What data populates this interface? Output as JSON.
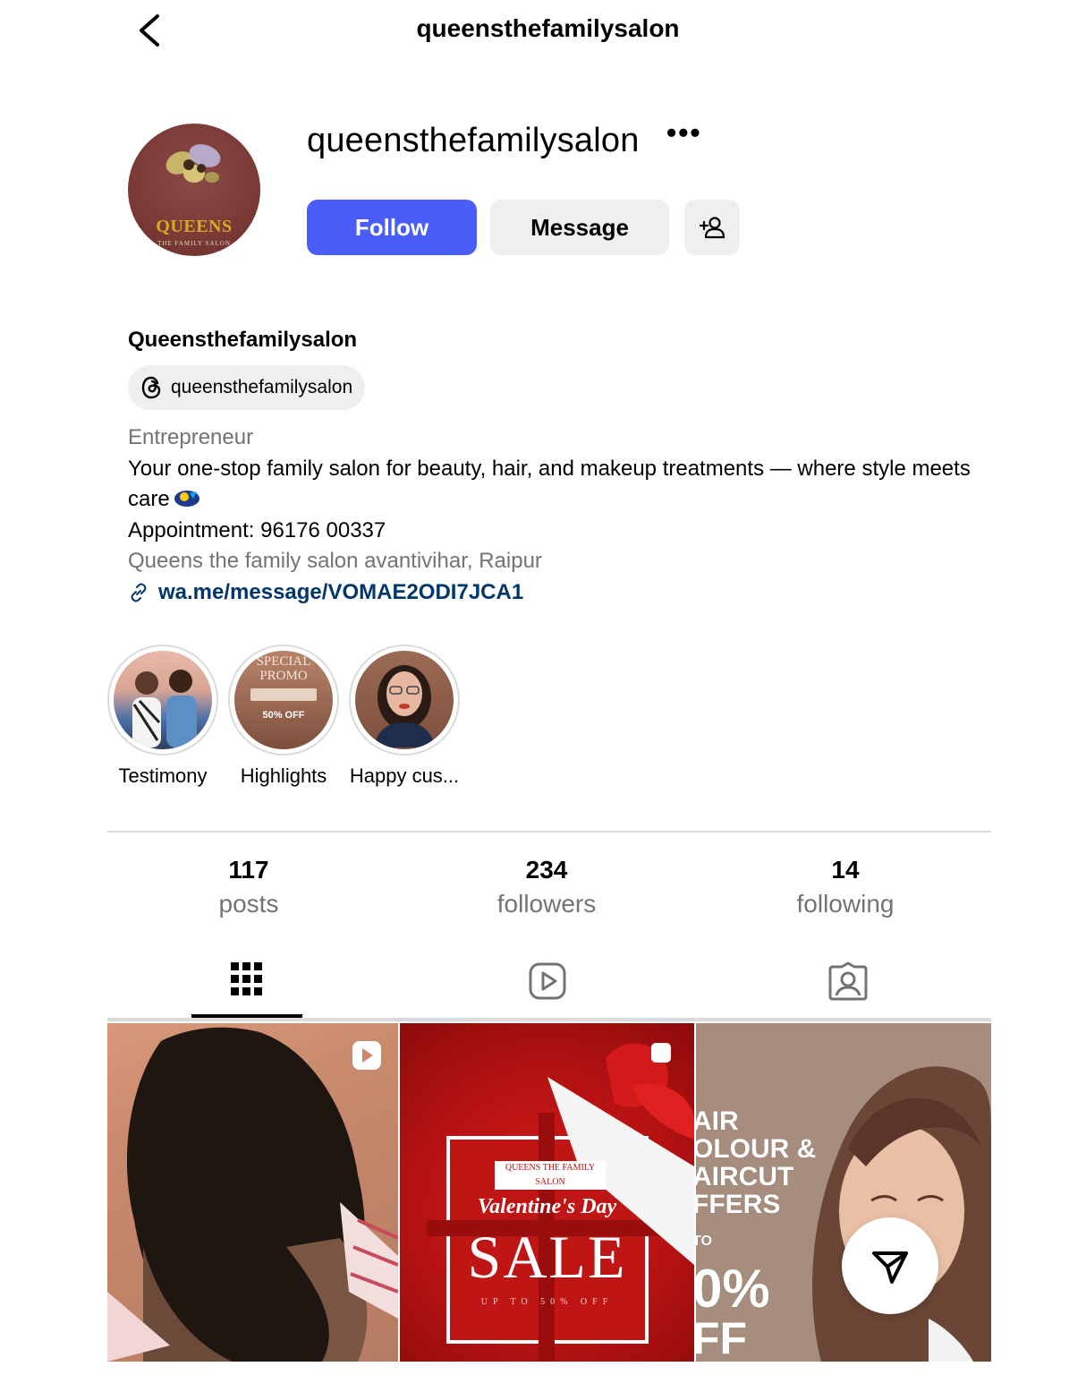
{
  "header": {
    "title": "queensthefamilysalon",
    "back_icon": "chevron-left-icon"
  },
  "profile": {
    "avatar_text": "QUEENS",
    "avatar_subtext": "THE FAMILY SALON",
    "username": "queensthefamilysalon",
    "more_label": "•••",
    "follow_label": "Follow",
    "message_label": "Message",
    "add_user_icon": "person-add-icon",
    "display_name": "Queensthefamilysalon",
    "threads_handle": "queensthefamilysalon",
    "category": "Entrepreneur",
    "bio_line1": "Your one-stop family salon for beauty, hair, and makeup treatments — where style meets care",
    "appointment": "Appointment: 96176 00337",
    "location": "Queens the family salon avantivihar, Raipur",
    "link": "wa.me/message/VOMAE2ODI7JCA1"
  },
  "highlights": [
    {
      "label": "Testimony"
    },
    {
      "label": "Highlights",
      "img_text_1": "SPECIAL",
      "img_text_2": "PROMO",
      "img_text_3": "50% OFF"
    },
    {
      "label": "Happy cus..."
    }
  ],
  "stats": {
    "posts_count": "117",
    "posts_label": "posts",
    "followers_count": "234",
    "followers_label": "followers",
    "following_count": "14",
    "following_label": "following"
  },
  "tabs": [
    "grid-icon",
    "reels-icon",
    "tagged-icon"
  ],
  "posts": {
    "post2_title": "QUEENS THE FAMILY SALON",
    "post2_script": "Valentine's Day",
    "post2_sale": "SALE",
    "post2_sub": "UP TO 50% OFF",
    "post3_line1": "AIR",
    "post3_line2": "OLOUR &",
    "post3_line3": "AIRCUT",
    "post3_line4": "FFERS",
    "post3_line5": "TO",
    "post3_line6": "0%",
    "post3_line7": "FF"
  },
  "colors": {
    "follow_button": "#4a5df9",
    "link": "#00376b",
    "secondary_text": "#737373",
    "button_gray": "#efefef"
  }
}
